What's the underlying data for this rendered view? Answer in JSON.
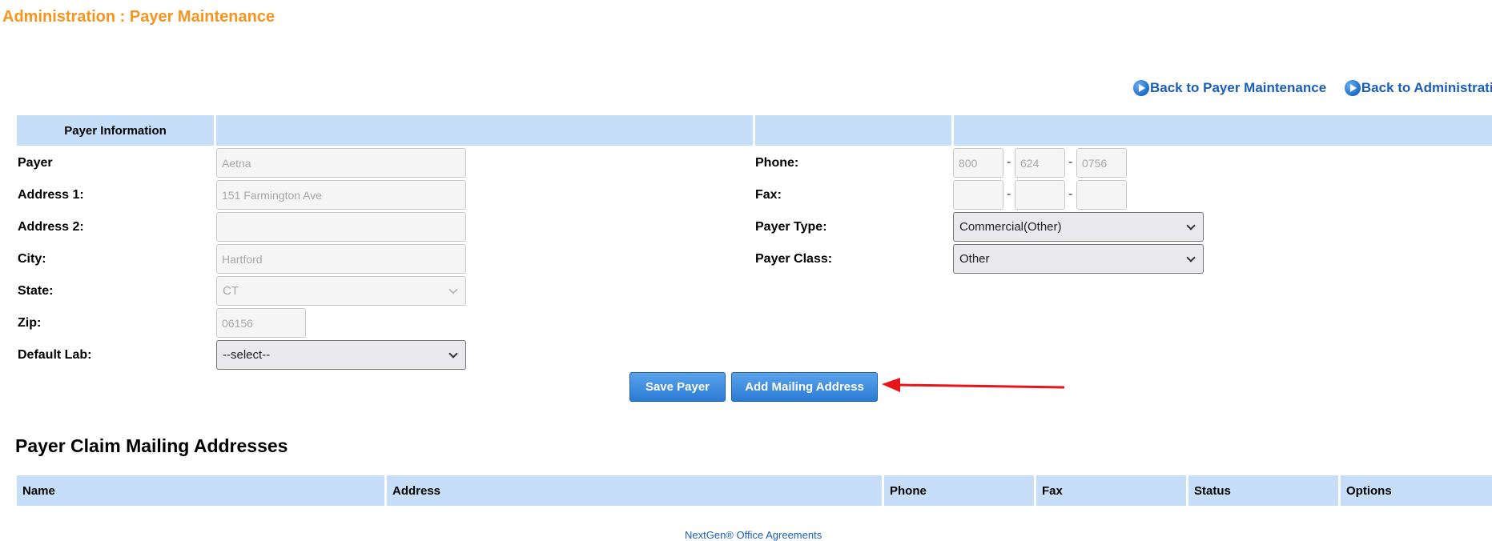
{
  "page": {
    "title": "Administration : Payer Maintenance"
  },
  "nav": {
    "back_to_payer": "Back to Payer Maintenance",
    "back_to_admin": "Back to Administration"
  },
  "form": {
    "section_header": "Payer Information",
    "payer": {
      "label": "Payer",
      "value": "Aetna"
    },
    "address1": {
      "label": "Address 1:",
      "value": "151 Farmington Ave"
    },
    "address2": {
      "label": "Address 2:",
      "value": ""
    },
    "city": {
      "label": "City:",
      "value": "Hartford"
    },
    "state": {
      "label": "State:",
      "value": "CT"
    },
    "zip": {
      "label": "Zip:",
      "value": "06156"
    },
    "default_lab": {
      "label": "Default Lab:",
      "value": "--select--"
    },
    "phone": {
      "label": "Phone:",
      "area": "800",
      "prefix": "624",
      "line": "0756",
      "sep": "-"
    },
    "fax": {
      "label": "Fax:",
      "area": "",
      "prefix": "",
      "line": "",
      "sep": "-"
    },
    "payer_type": {
      "label": "Payer Type:",
      "value": "Commercial(Other)"
    },
    "payer_class": {
      "label": "Payer Class:",
      "value": "Other"
    }
  },
  "buttons": {
    "save": "Save Payer",
    "add_mailing": "Add Mailing Address"
  },
  "mailing": {
    "title": "Payer Claim Mailing Addresses",
    "columns": [
      "Name",
      "Address",
      "Phone",
      "Fax",
      "Status",
      "Options"
    ]
  },
  "footer": {
    "link": "NextGen® Office Agreements"
  },
  "colors": {
    "title": "#f7941d",
    "header_bg": "#c6def7",
    "link": "#1a5dbb",
    "button": "#2a7bd4",
    "annotation": "#e8141a"
  }
}
